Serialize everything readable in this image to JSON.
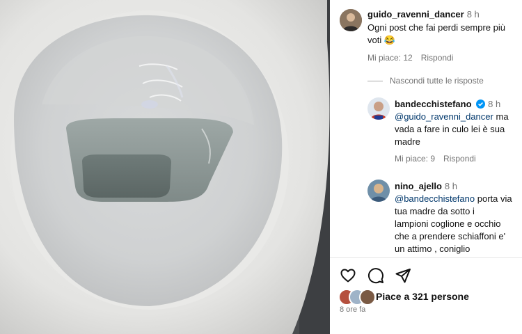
{
  "comments": [
    {
      "username": "guido_ravenni_dancer",
      "time": "8 h",
      "text": "Ogni post che fai perdi sempre più voti",
      "emoji": "😂",
      "likes": "Mi piace: 12",
      "reply": "Rispondi"
    },
    {
      "username": "bandecchistefano",
      "time": "8 h",
      "verified": true,
      "mention": "@guido_ravenni_dancer",
      "text_line1": "ma",
      "text_line2": "vada a fare in culo lei è sua",
      "text_line3": "madre",
      "likes": "Mi piace: 9",
      "reply": "Rispondi"
    },
    {
      "username": "nino_ajello",
      "time": "8 h",
      "mention": "@bandecchistefano",
      "text_line1": "porta via",
      "text_line2": "tua madre da sotto i",
      "text_line3": "lampioni coglione e occhio",
      "text_line4": "che a prendere schiaffoni e'",
      "text_line5": "un attimo , coniglio"
    }
  ],
  "hide_replies": "Nascondi tutte le risposte",
  "actions": {
    "like_icon": "heart-icon",
    "comment_icon": "comment-icon",
    "share_icon": "paper-plane-icon"
  },
  "likes_summary": {
    "prefix": "Piace a",
    "count": "321",
    "suffix": "persone"
  },
  "post_age": "8 ore fa",
  "colors": {
    "mention": "#00376b",
    "verified": "#0095f6",
    "muted": "#737373"
  }
}
